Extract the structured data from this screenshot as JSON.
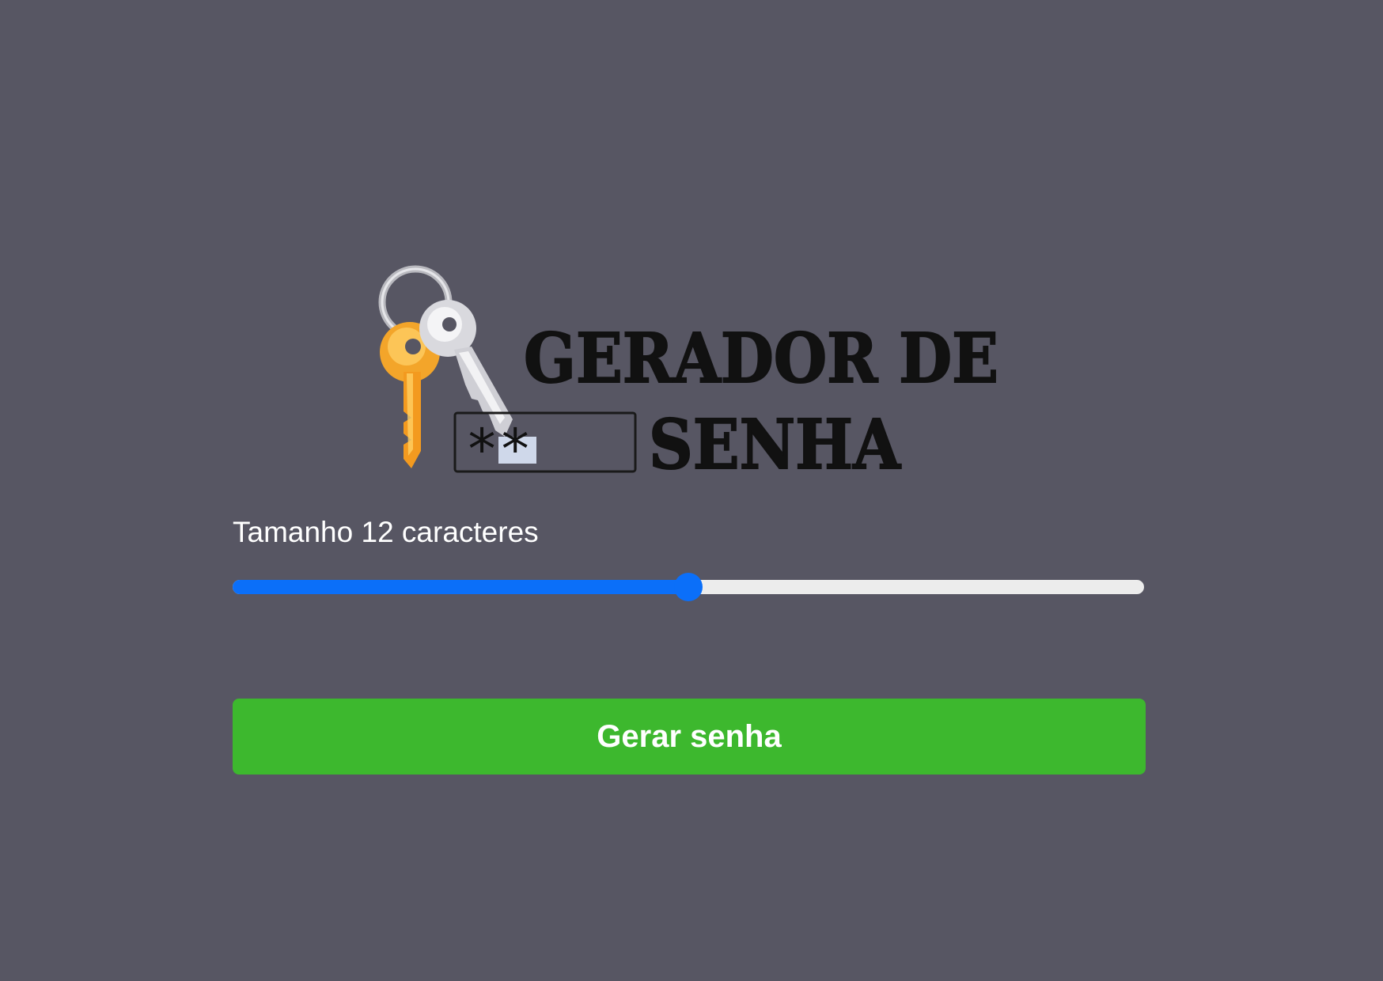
{
  "logo": {
    "title_line1": "GERADOR DE",
    "title_line2": "SENHA",
    "field_text": "**"
  },
  "controls": {
    "size_label": "Tamanho 12 caracteres",
    "slider_fraction": 0.5,
    "generate_button": "Gerar senha"
  },
  "colors": {
    "background": "#575663",
    "slider_fill": "#0b6ff9",
    "slider_track": "#ececec",
    "button": "#3db82e",
    "button_text": "#ffffff"
  },
  "icons": {
    "logo_icon": "keys-icon"
  }
}
